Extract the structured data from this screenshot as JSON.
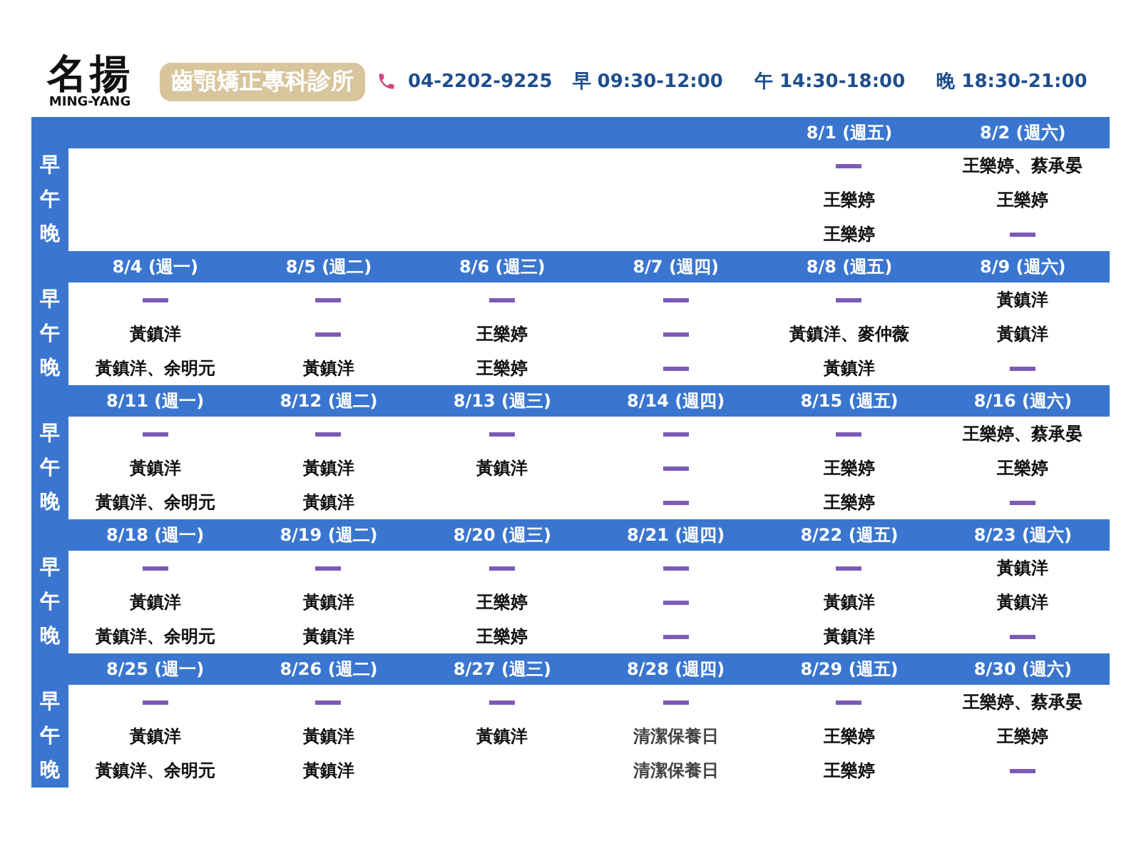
{
  "header": {
    "logo": "名揚",
    "logo_subtitle": "MING-YANG",
    "clinic_badge": "齒顎矯正專科診所",
    "phone": "04-2202-9225",
    "hours": [
      "早 09:30-12:00",
      "午 14:30-18:00",
      "晚 18:30-21:00"
    ]
  },
  "weeks": [
    {
      "sessions": [
        "早",
        "午",
        "晚"
      ],
      "days": [
        {
          "kind": "blank"
        },
        {
          "kind": "blank"
        },
        {
          "kind": "blank"
        },
        {
          "kind": "blank"
        },
        {
          "kind": "day",
          "date": "8/1 (週五)",
          "slots": [
            {
              "kind": "off"
            },
            {
              "kind": "doctor",
              "text": "王樂婷"
            },
            {
              "kind": "doctor",
              "text": "王樂婷"
            }
          ]
        },
        {
          "kind": "day",
          "date": "8/2 (週六)",
          "slots": [
            {
              "kind": "doctor",
              "text": "王樂婷、蔡承晏"
            },
            {
              "kind": "doctor",
              "text": "王樂婷"
            },
            {
              "kind": "off"
            }
          ]
        }
      ]
    },
    {
      "sessions": [
        "早",
        "午",
        "晚"
      ],
      "days": [
        {
          "kind": "day",
          "date": "8/4 (週一)",
          "slots": [
            {
              "kind": "off"
            },
            {
              "kind": "doctor",
              "text": "黃鎮洋"
            },
            {
              "kind": "doctor",
              "text": "黃鎮洋、余明元"
            }
          ]
        },
        {
          "kind": "day",
          "date": "8/5 (週二)",
          "slots": [
            {
              "kind": "off"
            },
            {
              "kind": "off"
            },
            {
              "kind": "doctor",
              "text": "黃鎮洋"
            }
          ]
        },
        {
          "kind": "day",
          "date": "8/6 (週三)",
          "slots": [
            {
              "kind": "off"
            },
            {
              "kind": "doctor",
              "text": "王樂婷"
            },
            {
              "kind": "doctor",
              "text": "王樂婷"
            }
          ]
        },
        {
          "kind": "day",
          "date": "8/7 (週四)",
          "slots": [
            {
              "kind": "off"
            },
            {
              "kind": "off"
            },
            {
              "kind": "off"
            }
          ]
        },
        {
          "kind": "day",
          "date": "8/8 (週五)",
          "slots": [
            {
              "kind": "off"
            },
            {
              "kind": "doctor",
              "text": "黃鎮洋、麥仲薇"
            },
            {
              "kind": "doctor",
              "text": "黃鎮洋"
            }
          ]
        },
        {
          "kind": "day",
          "date": "8/9 (週六)",
          "slots": [
            {
              "kind": "doctor",
              "text": "黃鎮洋"
            },
            {
              "kind": "doctor",
              "text": "黃鎮洋"
            },
            {
              "kind": "off"
            }
          ]
        }
      ]
    },
    {
      "sessions": [
        "早",
        "午",
        "晚"
      ],
      "days": [
        {
          "kind": "day",
          "date": "8/11 (週一)",
          "slots": [
            {
              "kind": "off"
            },
            {
              "kind": "doctor",
              "text": "黃鎮洋"
            },
            {
              "kind": "doctor",
              "text": "黃鎮洋、余明元"
            }
          ]
        },
        {
          "kind": "day",
          "date": "8/12 (週二)",
          "slots": [
            {
              "kind": "off"
            },
            {
              "kind": "doctor",
              "text": "黃鎮洋"
            },
            {
              "kind": "doctor",
              "text": "黃鎮洋"
            }
          ]
        },
        {
          "kind": "day",
          "date": "8/13 (週三)",
          "slots": [
            {
              "kind": "off"
            },
            {
              "kind": "doctor",
              "text": "黃鎮洋"
            },
            {
              "kind": "empty"
            }
          ]
        },
        {
          "kind": "day",
          "date": "8/14 (週四)",
          "slots": [
            {
              "kind": "off"
            },
            {
              "kind": "off"
            },
            {
              "kind": "off"
            }
          ]
        },
        {
          "kind": "day",
          "date": "8/15 (週五)",
          "slots": [
            {
              "kind": "off"
            },
            {
              "kind": "doctor",
              "text": "王樂婷"
            },
            {
              "kind": "doctor",
              "text": "王樂婷"
            }
          ]
        },
        {
          "kind": "day",
          "date": "8/16 (週六)",
          "slots": [
            {
              "kind": "doctor",
              "text": "王樂婷、蔡承晏"
            },
            {
              "kind": "doctor",
              "text": "王樂婷"
            },
            {
              "kind": "off"
            }
          ]
        }
      ]
    },
    {
      "sessions": [
        "早",
        "午",
        "晚"
      ],
      "days": [
        {
          "kind": "day",
          "date": "8/18 (週一)",
          "slots": [
            {
              "kind": "off"
            },
            {
              "kind": "doctor",
              "text": "黃鎮洋"
            },
            {
              "kind": "doctor",
              "text": "黃鎮洋、余明元"
            }
          ]
        },
        {
          "kind": "day",
          "date": "8/19 (週二)",
          "slots": [
            {
              "kind": "off"
            },
            {
              "kind": "doctor",
              "text": "黃鎮洋"
            },
            {
              "kind": "doctor",
              "text": "黃鎮洋"
            }
          ]
        },
        {
          "kind": "day",
          "date": "8/20 (週三)",
          "slots": [
            {
              "kind": "off"
            },
            {
              "kind": "doctor",
              "text": "王樂婷"
            },
            {
              "kind": "doctor",
              "text": "王樂婷"
            }
          ]
        },
        {
          "kind": "day",
          "date": "8/21 (週四)",
          "slots": [
            {
              "kind": "off"
            },
            {
              "kind": "off"
            },
            {
              "kind": "off"
            }
          ]
        },
        {
          "kind": "day",
          "date": "8/22 (週五)",
          "slots": [
            {
              "kind": "off"
            },
            {
              "kind": "doctor",
              "text": "黃鎮洋"
            },
            {
              "kind": "doctor",
              "text": "黃鎮洋"
            }
          ]
        },
        {
          "kind": "day",
          "date": "8/23 (週六)",
          "slots": [
            {
              "kind": "doctor",
              "text": "黃鎮洋"
            },
            {
              "kind": "doctor",
              "text": "黃鎮洋"
            },
            {
              "kind": "off"
            }
          ]
        }
      ]
    },
    {
      "sessions": [
        "早",
        "午",
        "晚"
      ],
      "days": [
        {
          "kind": "day",
          "date": "8/25 (週一)",
          "slots": [
            {
              "kind": "off"
            },
            {
              "kind": "doctor",
              "text": "黃鎮洋"
            },
            {
              "kind": "doctor",
              "text": "黃鎮洋、余明元"
            }
          ]
        },
        {
          "kind": "day",
          "date": "8/26 (週二)",
          "slots": [
            {
              "kind": "off"
            },
            {
              "kind": "doctor",
              "text": "黃鎮洋"
            },
            {
              "kind": "doctor",
              "text": "黃鎮洋"
            }
          ]
        },
        {
          "kind": "day",
          "date": "8/27 (週三)",
          "slots": [
            {
              "kind": "off"
            },
            {
              "kind": "doctor",
              "text": "黃鎮洋"
            },
            {
              "kind": "empty"
            }
          ]
        },
        {
          "kind": "day",
          "date": "8/28 (週四)",
          "slots": [
            {
              "kind": "off"
            },
            {
              "kind": "note",
              "text": "清潔保養日"
            },
            {
              "kind": "note",
              "text": "清潔保養日"
            }
          ]
        },
        {
          "kind": "day",
          "date": "8/29 (週五)",
          "slots": [
            {
              "kind": "off"
            },
            {
              "kind": "doctor",
              "text": "王樂婷"
            },
            {
              "kind": "doctor",
              "text": "王樂婷"
            }
          ]
        },
        {
          "kind": "day",
          "date": "8/30 (週六)",
          "slots": [
            {
              "kind": "doctor",
              "text": "王樂婷、蔡承晏"
            },
            {
              "kind": "doctor",
              "text": "王樂婷"
            },
            {
              "kind": "off"
            }
          ]
        }
      ]
    }
  ]
}
